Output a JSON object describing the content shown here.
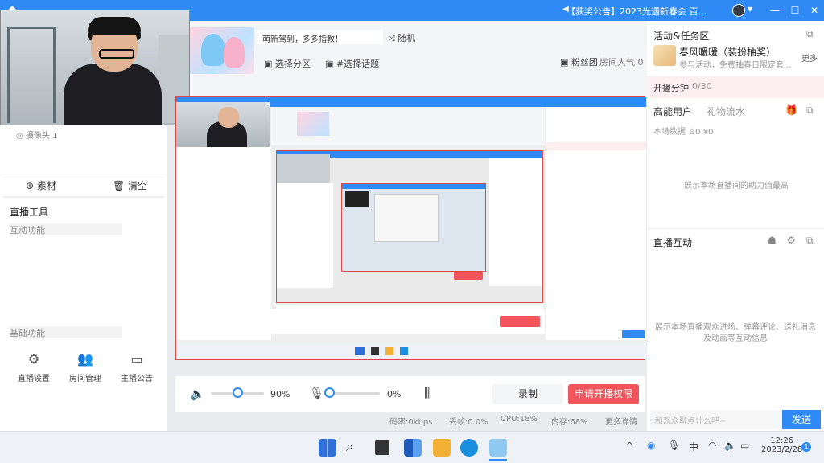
{
  "titlebar": {
    "notice": "【获奖公告】2023光遇新春会 百..."
  },
  "webcam": {
    "label": "摄像头 1"
  },
  "left": {
    "material_label": "素材",
    "clear_label": "清空",
    "tools_title": "直播工具",
    "interactive_label": "互动功能",
    "basic_label": "基础功能",
    "tools": [
      {
        "label": "直播设置",
        "icon": "gear-icon"
      },
      {
        "label": "房间管理",
        "icon": "users-icon"
      },
      {
        "label": "主播公告",
        "icon": "announcement-icon"
      }
    ]
  },
  "room": {
    "title_value": "萌新驾到，多多指教！",
    "random_label": "随机",
    "category_label": "选择分区",
    "topic_label": "#选择话题",
    "fans_label": "粉丝团",
    "popularity_label": "房间人气 0"
  },
  "bottom": {
    "volume_pct": "90%",
    "volume_level": 0.5,
    "mic_pct": "0%",
    "mic_level": 0.05,
    "record_label": "录制",
    "apply_label": "申请开播权限"
  },
  "status": {
    "bitrate": "码率:0kbps",
    "dropped": "丢帧:0.0%",
    "cpu": "CPU:18%",
    "memory": "内存:68%",
    "more": "更多详情"
  },
  "right": {
    "activity_title": "活动&任务区",
    "activity_name": "春风暖暖（装扮柚奖）",
    "activity_desc": "参与活动，免费抽春日限定套...",
    "more_label": "更多",
    "progress_label": "开播分钟",
    "progress_value": "0/30",
    "high_users_tab": "高能用户",
    "gift_tab": "礼物流水",
    "this_show_label": "本场数据",
    "this_show_people": "0",
    "this_show_money": "¥0",
    "empty_high": "展示本场直播间的助力值最高",
    "live_interact_title": "直播互动",
    "live_interact_desc": "展示本场直播观众进场、弹幕评论、送礼消息及动画等互动信息",
    "chat_placeholder": "和观众聊点什么吧~",
    "send_label": "发送"
  },
  "taskbar": {
    "time": "12:26",
    "date": "2023/2/28",
    "ime": "中",
    "notif_count": "1"
  },
  "colors": {
    "accent": "#2f8af5",
    "danger": "#f2545b"
  }
}
